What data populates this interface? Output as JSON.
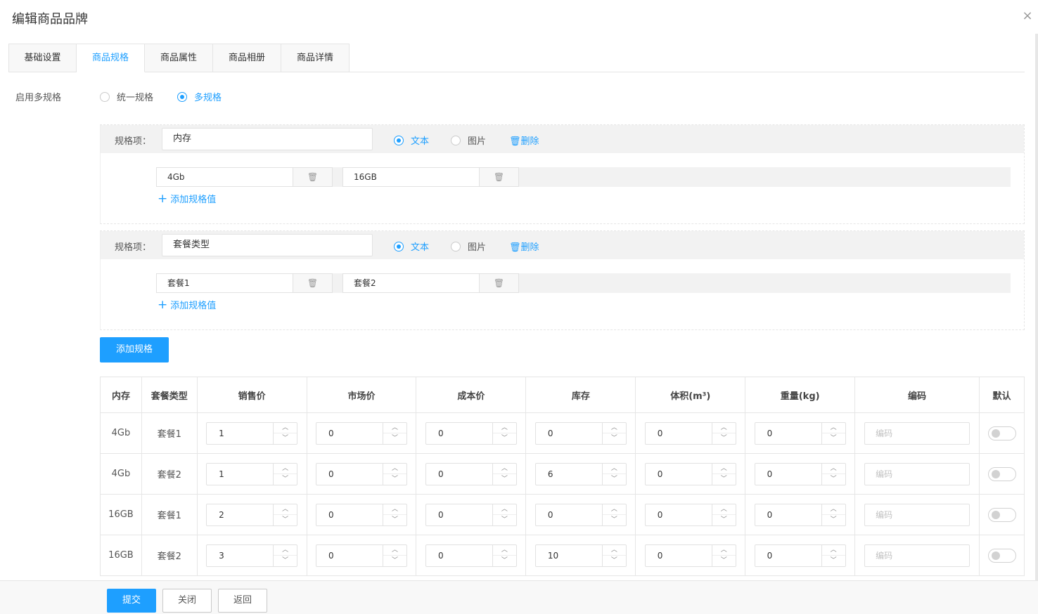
{
  "dialog": {
    "title": "编辑商品品牌",
    "close_label": "×"
  },
  "tabs": [
    {
      "label": "基础设置",
      "active": false
    },
    {
      "label": "商品规格",
      "active": true
    },
    {
      "label": "商品属性",
      "active": false
    },
    {
      "label": "商品相册",
      "active": false
    },
    {
      "label": "商品详情",
      "active": false
    }
  ],
  "multi_spec": {
    "label": "启用多规格",
    "options": [
      {
        "label": "统一规格",
        "checked": false
      },
      {
        "label": "多规格",
        "checked": true
      }
    ]
  },
  "spec_groups": [
    {
      "label": "规格项：",
      "name": "内存",
      "type_options": [
        {
          "label": "文本",
          "checked": true
        },
        {
          "label": "图片",
          "checked": false
        }
      ],
      "delete_label": "删除",
      "delete_icon": "trash-icon",
      "values": [
        "4Gb",
        "16GB"
      ],
      "add_value_label": "添加规格值"
    },
    {
      "label": "规格项：",
      "name": "套餐类型",
      "type_options": [
        {
          "label": "文本",
          "checked": true
        },
        {
          "label": "图片",
          "checked": false
        }
      ],
      "delete_label": "删除",
      "delete_icon": "trash-icon",
      "values": [
        "套餐1",
        "套餐2"
      ],
      "add_value_label": "添加规格值"
    }
  ],
  "add_spec_label": "添加规格",
  "sku_table": {
    "headers": [
      "内存",
      "套餐类型",
      "销售价",
      "市场价",
      "成本价",
      "库存",
      "体积(m³)",
      "重量(kg)",
      "编码",
      "默认"
    ],
    "code_placeholder": "编码",
    "rows": [
      {
        "mem": "4Gb",
        "pkg": "套餐1",
        "nums": [
          "1",
          "0",
          "0",
          "0",
          "0",
          "0"
        ],
        "default": false
      },
      {
        "mem": "4Gb",
        "pkg": "套餐2",
        "nums": [
          "1",
          "0",
          "0",
          "6",
          "0",
          "0"
        ],
        "default": false
      },
      {
        "mem": "16GB",
        "pkg": "套餐1",
        "nums": [
          "2",
          "0",
          "0",
          "0",
          "0",
          "0"
        ],
        "default": false
      },
      {
        "mem": "16GB",
        "pkg": "套餐2",
        "nums": [
          "3",
          "0",
          "0",
          "10",
          "0",
          "0"
        ],
        "default": false
      }
    ]
  },
  "footer": {
    "submit_label": "提交",
    "close_label": "关闭",
    "back_label": "返回"
  },
  "colors": {
    "accent": "#1e9fff",
    "border": "#e6e6e6",
    "header_bg": "#f2f2f2"
  }
}
